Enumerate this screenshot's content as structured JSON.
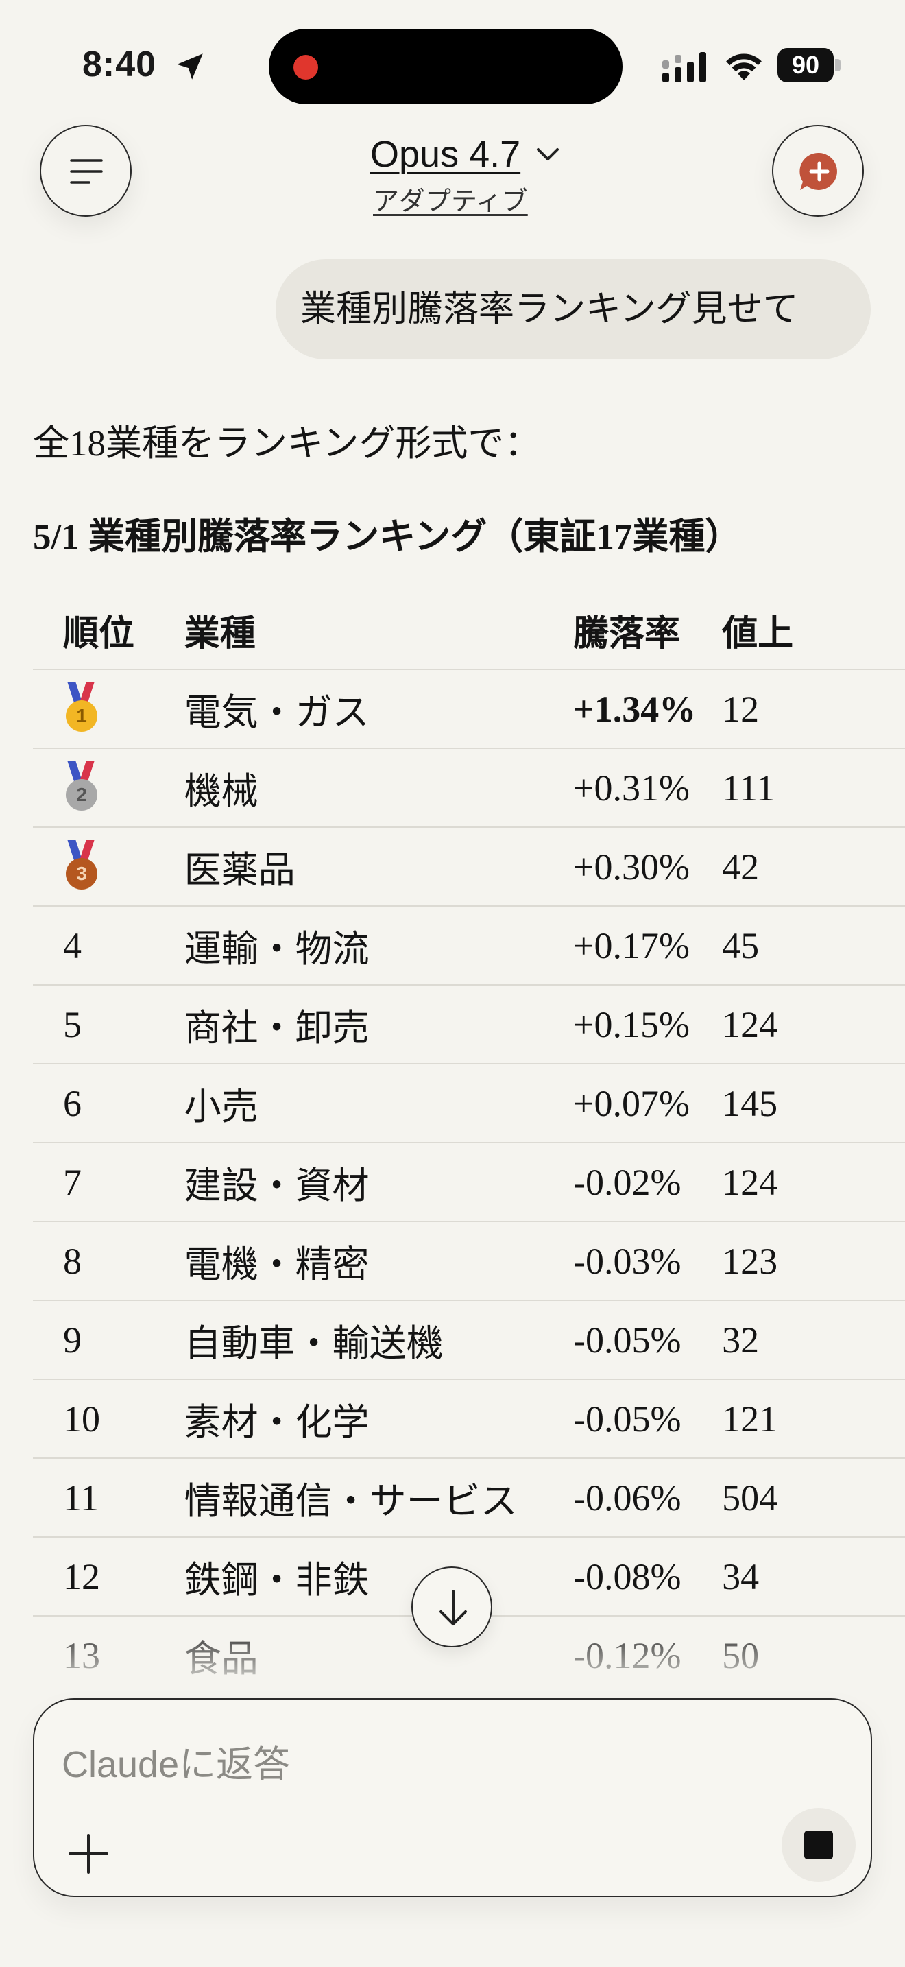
{
  "status_bar": {
    "time": "8:40",
    "battery": "90"
  },
  "header": {
    "model_name": "Opus 4.7",
    "model_mode": "アダプティブ"
  },
  "user_message": "業種別騰落率ランキング見せて",
  "response": {
    "intro": "全18業種をランキング形式で：",
    "heading": "5/1 業種別騰落率ランキング（東証17業種）"
  },
  "table": {
    "headers": [
      "順位",
      "業種",
      "騰落率",
      "値上"
    ],
    "rows": [
      {
        "rank": "1",
        "medal": "gold",
        "industry": "電気・ガス",
        "rate": "+1.34%",
        "advancers": "12"
      },
      {
        "rank": "2",
        "medal": "silver",
        "industry": "機械",
        "rate": "+0.31%",
        "advancers": "111"
      },
      {
        "rank": "3",
        "medal": "bronze",
        "industry": "医薬品",
        "rate": "+0.30%",
        "advancers": "42"
      },
      {
        "rank": "4",
        "industry": "運輸・物流",
        "rate": "+0.17%",
        "advancers": "45"
      },
      {
        "rank": "5",
        "industry": "商社・卸売",
        "rate": "+0.15%",
        "advancers": "124"
      },
      {
        "rank": "6",
        "industry": "小売",
        "rate": "+0.07%",
        "advancers": "145"
      },
      {
        "rank": "7",
        "industry": "建設・資材",
        "rate": "-0.02%",
        "advancers": "124"
      },
      {
        "rank": "8",
        "industry": "電機・精密",
        "rate": "-0.03%",
        "advancers": "123"
      },
      {
        "rank": "9",
        "industry": "自動車・輸送機",
        "rate": "-0.05%",
        "advancers": "32"
      },
      {
        "rank": "10",
        "industry": "素材・化学",
        "rate": "-0.05%",
        "advancers": "121"
      },
      {
        "rank": "11",
        "industry": "情報通信・サービス",
        "rate": "-0.06%",
        "advancers": "504"
      },
      {
        "rank": "12",
        "industry": "鉄鋼・非鉄",
        "rate": "-0.08%",
        "advancers": "34"
      },
      {
        "rank": "13",
        "industry": "食品",
        "rate": "-0.12%",
        "advancers": "50"
      }
    ]
  },
  "composer": {
    "placeholder": "Claudeに返答"
  },
  "colors": {
    "background": "#f5f4ef",
    "accent": "#c0523a",
    "recording": "#e0362d"
  }
}
